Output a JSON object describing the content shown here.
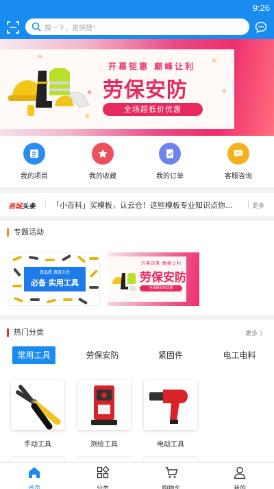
{
  "status_bar": {
    "time": "9:26"
  },
  "header": {
    "search_placeholder": "搜一下，更快捷！",
    "brand_color": "#1a8cf0"
  },
  "banner": {
    "headline_small": "开幕钜惠  巅峰让利",
    "headline_big": "劳保安防",
    "badge": "全场超低价优惠"
  },
  "quick_links": [
    {
      "label": "我的项目",
      "icon": "document-list-icon",
      "color": "#2d8cf0"
    },
    {
      "label": "我的收藏",
      "icon": "star-icon",
      "color": "#ef4f5a"
    },
    {
      "label": "我的订单",
      "icon": "order-check-icon",
      "color": "#6d84ea"
    },
    {
      "label": "客服咨询",
      "icon": "chat-bubble-icon",
      "color": "#f5b21c"
    }
  ],
  "news": {
    "logo_a": "商城",
    "logo_b": "头条",
    "headline": "「小百科」买模板，认云仓！这些模板专业知识点你...",
    "more": "更多"
  },
  "topic": {
    "title": "专题活动",
    "tools_card": {
      "tag_small": "真品质  真百元仓",
      "tag_big": "必备 实用工具"
    },
    "safety_card": {
      "line1": "开幕钜惠  巅峰让利",
      "line2": "劳保安防",
      "line3": "全场超低价优惠"
    }
  },
  "hot": {
    "title": "热门分类",
    "more": "更多 〉",
    "tabs": [
      "常用工具",
      "劳保安防",
      "紧固件",
      "电工电料"
    ],
    "active_tab": 0,
    "products": [
      {
        "name": "手动工具",
        "icon": "pliers-icon"
      },
      {
        "name": "测绘工具",
        "icon": "laser-level-icon"
      },
      {
        "name": "电动工具",
        "icon": "heat-gun-icon"
      }
    ]
  },
  "tabbar": {
    "items": [
      {
        "label": "首页",
        "icon": "home-icon"
      },
      {
        "label": "分类",
        "icon": "category-grid-icon"
      },
      {
        "label": "购物车",
        "icon": "cart-icon"
      },
      {
        "label": "我的",
        "icon": "user-icon"
      }
    ],
    "active": 0
  }
}
